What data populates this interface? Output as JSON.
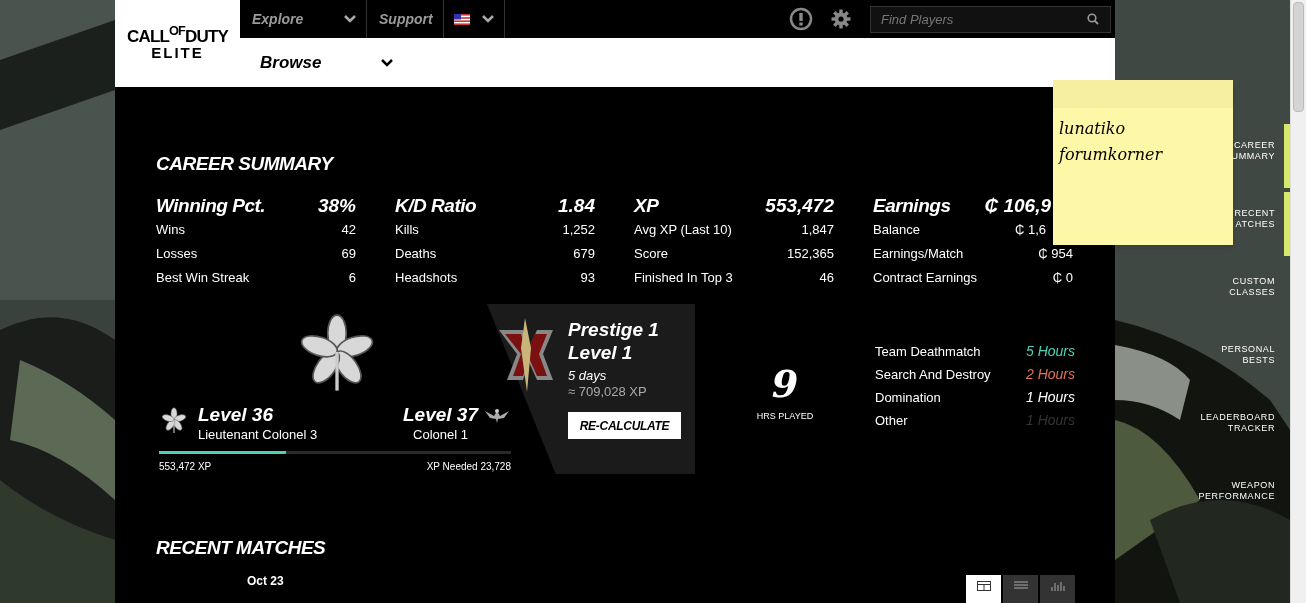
{
  "header": {
    "logo": {
      "top": "CALL$^{OF}$DUTY",
      "bottom": "ELITE"
    },
    "nav": [
      {
        "label": "Explore",
        "dropdown": true
      },
      {
        "label": "Support",
        "dropdown": false
      }
    ],
    "language": {
      "dropdown": true
    },
    "search": {
      "placeholder": "Find Players"
    },
    "subnav": {
      "label": "Browse",
      "dropdown": true
    }
  },
  "career_summary": {
    "title": "CAREER SUMMARY",
    "groups": [
      {
        "title": "Winning Pct.",
        "value": "38%",
        "rows": [
          {
            "label": "Wins",
            "value": "42"
          },
          {
            "label": "Losses",
            "value": "69"
          },
          {
            "label": "Best Win Streak",
            "value": "6"
          }
        ]
      },
      {
        "title": "K/D Ratio",
        "value": "1.84",
        "rows": [
          {
            "label": "Kills",
            "value": "1,252"
          },
          {
            "label": "Deaths",
            "value": "679"
          },
          {
            "label": "Headshots",
            "value": "93"
          }
        ]
      },
      {
        "title": "XP",
        "value": "553,472",
        "rows": [
          {
            "label": "Avg XP (Last 10)",
            "value": "1,847"
          },
          {
            "label": "Score",
            "value": "152,365"
          },
          {
            "label": "Finished In Top 3",
            "value": "46"
          }
        ]
      },
      {
        "title": "Earnings",
        "value": "₵ 106,9",
        "rows": [
          {
            "label": "Balance",
            "value": "₵ 1,6"
          },
          {
            "label": "Earnings/Match",
            "value": "₵ 954"
          },
          {
            "label": "Contract Earnings",
            "value": "₵ 0"
          }
        ]
      }
    ]
  },
  "rank": {
    "current_level": "Level 36",
    "current_rank": "Lieutenant Colonel 3",
    "next_level": "Level 37",
    "next_rank": "Colonel 1",
    "level": 0.36,
    "xp": "553,472 XP",
    "xp_needed": "XP Needed 23,728"
  },
  "prestige": {
    "title": "Prestige 1",
    "subtitle": "Level 1",
    "time": "5 days",
    "xp": "≈ 709,028 XP",
    "button": "RE-CALCULATE"
  },
  "hours": {
    "value": "9",
    "label": "HRS PLAYED",
    "modes": [
      {
        "name": "Team Deathmatch",
        "hours": "5 Hours",
        "color": "#4fd1b5"
      },
      {
        "name": "Search And Destroy",
        "hours": "2 Hours",
        "color": "#e0705a"
      },
      {
        "name": "Domination",
        "hours": "1 Hours",
        "color": "#ffffff"
      },
      {
        "name": "Other",
        "hours": "1 Hours",
        "color": "#333333"
      }
    ]
  },
  "recent_matches": {
    "title": "RECENT MATCHES",
    "date": "Oct 23",
    "views": [
      {
        "kind": "cards",
        "selected": true
      },
      {
        "kind": "list",
        "selected": false
      },
      {
        "kind": "chart",
        "selected": false
      }
    ]
  },
  "side_nav": [
    {
      "label": "CAREER\nUMMARY",
      "selected": true
    },
    {
      "label": "RECENT\nATCHES",
      "selected": true
    },
    {
      "label": "CUSTOM\nCLASSES",
      "selected": false
    },
    {
      "label": "PERSONAL\nBESTS",
      "selected": false
    },
    {
      "label": "LEADERBOARD\nTRACKER",
      "selected": false
    },
    {
      "label": "WEAPON\nPERFORMANCE",
      "selected": false
    }
  ],
  "sticky_note": {
    "lines": [
      "lunatiko",
      "forumkorner"
    ]
  }
}
